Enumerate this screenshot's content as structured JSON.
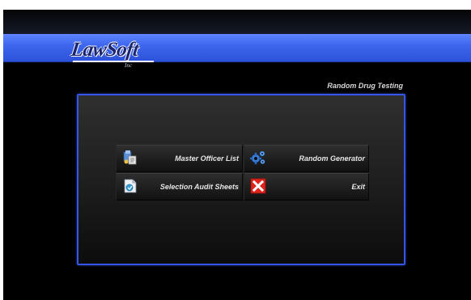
{
  "app": {
    "logo_text": "LawSoft",
    "logo_sub": "Inc",
    "subtitle": "Random Drug Testing"
  },
  "menu": {
    "master_officer_list": {
      "label": "Master Officer List",
      "icon": "officer-list-icon"
    },
    "random_generator": {
      "label": "Random Generator",
      "icon": "gears-icon"
    },
    "selection_audit_sheets": {
      "label": "Selection Audit Sheets",
      "icon": "audit-sheet-icon"
    },
    "exit": {
      "label": "Exit",
      "icon": "red-x-icon"
    }
  },
  "colors": {
    "header_blue": "#3e67ef",
    "panel_border": "#3355ee",
    "background": "#000000",
    "exit_red": "#e0241c"
  }
}
